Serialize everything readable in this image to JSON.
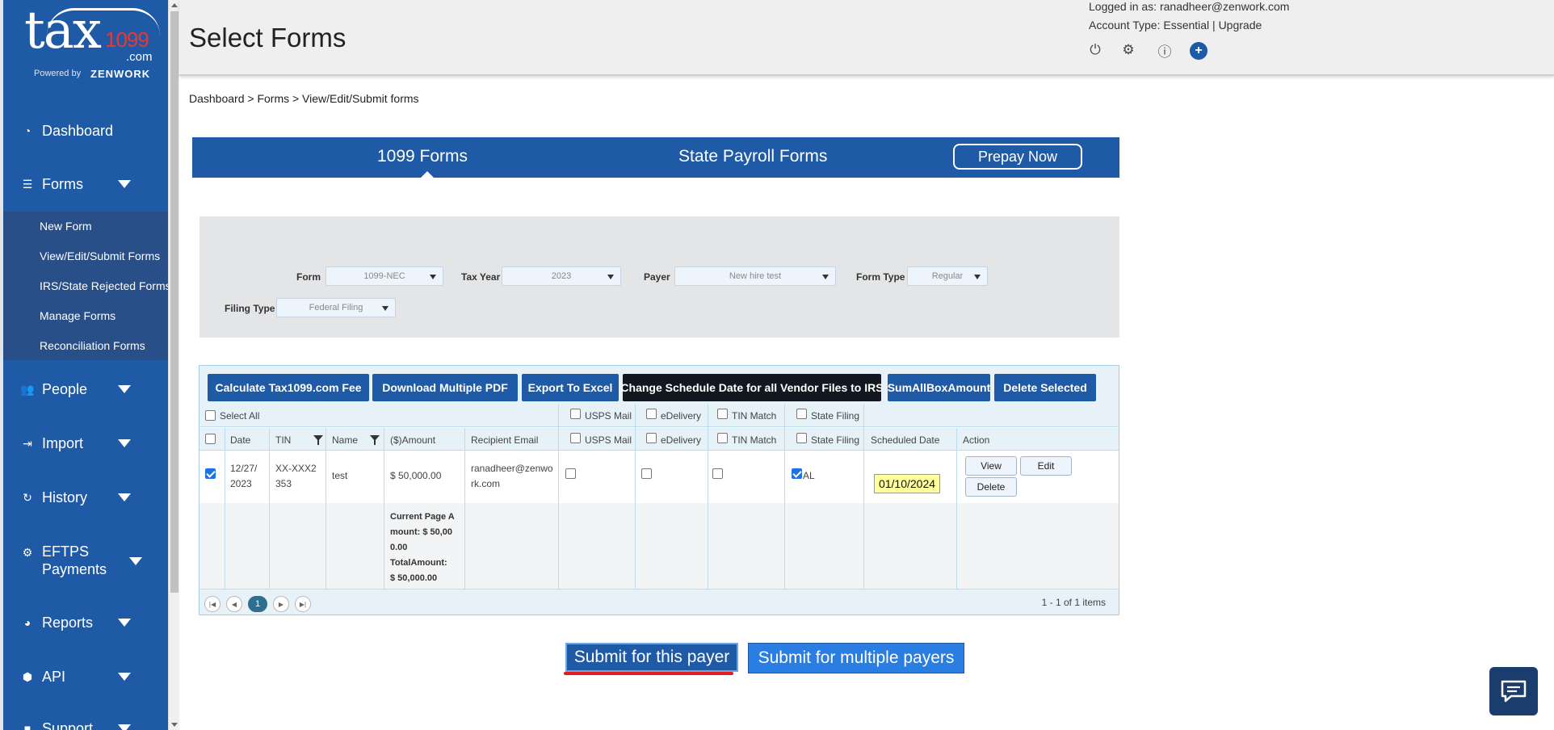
{
  "sidebar": {
    "logo_text": "tax",
    "logo_num": "1099",
    "logo_com": ".com",
    "powered_by": "Powered by",
    "brand": "ZENWORK",
    "items": [
      {
        "label": "Dashboard",
        "icon": "dashboard-icon"
      },
      {
        "label": "Forms",
        "icon": "forms-icon"
      },
      {
        "label": "People",
        "icon": "people-icon"
      },
      {
        "label": "Import",
        "icon": "import-icon"
      },
      {
        "label": "History",
        "icon": "history-icon"
      },
      {
        "label": "EFTPS",
        "label2": "Payments",
        "icon": "eftps-icon"
      },
      {
        "label": "Reports",
        "icon": "reports-icon"
      },
      {
        "label": "API",
        "icon": "api-icon"
      },
      {
        "label": "Support",
        "icon": "support-icon"
      }
    ],
    "forms_sub": [
      "New Form",
      "View/Edit/Submit Forms",
      "IRS/State Rejected Forms",
      "Manage Forms",
      "Reconciliation Forms"
    ]
  },
  "header": {
    "title": "Select Forms",
    "logged_in": "Logged in as: ranadheer@zenwork.com",
    "account_type": "Account Type: Essential | Upgrade"
  },
  "breadcrumb": "Dashboard > Forms > View/Edit/Submit forms",
  "tabs": {
    "forms_1099": "1099 Forms",
    "state_payroll": "State Payroll Forms",
    "prepay": "Prepay Now"
  },
  "filters": {
    "form_label": "Form",
    "form_value": "1099-NEC",
    "tax_year_label": "Tax Year",
    "tax_year_value": "2023",
    "payer_label": "Payer",
    "payer_value": "New hire test",
    "form_type_label": "Form Type",
    "form_type_value": "Regular",
    "filing_type_label": "Filing Type",
    "filing_type_value": "Federal Filing"
  },
  "toolbar": {
    "calc_fee": "Calculate Tax1099.com Fee",
    "download_pdf": "Download Multiple PDF",
    "export_excel": "Export To Excel",
    "change_schedule": "Change Schedule Date for all Vendor Files to IRS",
    "sum_all": "SumAllBoxAmount",
    "delete_selected": "Delete Selected"
  },
  "grid": {
    "select_all": "Select All",
    "usps_mail": "USPS Mail",
    "edelivery": "eDelivery",
    "tin_match": "TIN Match",
    "state_filing": "State Filing",
    "columns": {
      "date": "Date",
      "tin": "TIN",
      "name": "Name",
      "amount": "($)Amount",
      "email": "Recipient Email",
      "scheduled_date": "Scheduled Date",
      "action": "Action"
    },
    "row": {
      "date_1": "12/27/",
      "date_2": "2023",
      "tin_1": "XX-XXX2",
      "tin_2": "353",
      "name": "test",
      "amount": "$ 50,000.00",
      "email_1": "ranadheer@zenwo",
      "email_2": "rk.com",
      "state": "AL",
      "scheduled": "01/10/2024",
      "view": "View",
      "edit": "Edit",
      "delete": "Delete"
    },
    "totals": {
      "line1": "Current Page A",
      "line2": "mount: $ 50,00",
      "line3": "0.00",
      "line4": "TotalAmount:",
      "line5": "$ 50,000.00"
    },
    "pager": {
      "current_page": "1",
      "items_info": "1 - 1 of 1 items"
    }
  },
  "submit": {
    "this_payer": "Submit for this payer",
    "multiple_payers": "Submit for multiple payers"
  },
  "colors": {
    "brand_blue": "#1f5aa6",
    "highlight_yellow": "#ffff9c",
    "underline_red": "#e02020"
  }
}
